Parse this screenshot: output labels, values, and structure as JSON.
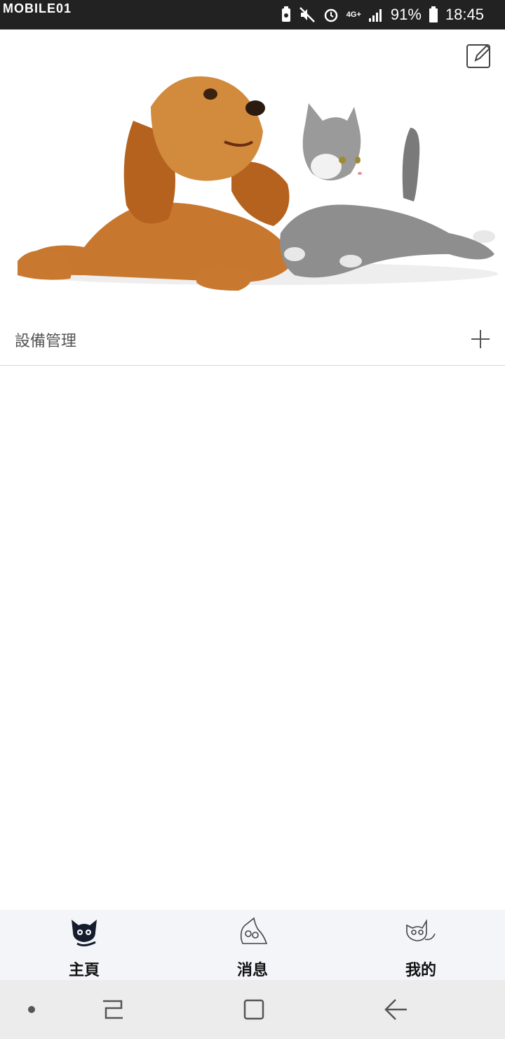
{
  "status_bar": {
    "watermark": "MOBILE01",
    "network": "4G+",
    "battery": "91%",
    "time": "18:45"
  },
  "hero": {
    "image": "dog-and-cat-photo",
    "edit_icon": "edit-icon"
  },
  "devices": {
    "title": "設備管理",
    "add_icon": "plus-icon"
  },
  "tabs": [
    {
      "label": "主頁",
      "icon": "cat-home-icon",
      "active": true
    },
    {
      "label": "消息",
      "icon": "cat-message-icon",
      "active": false
    },
    {
      "label": "我的",
      "icon": "cat-profile-icon",
      "active": false
    }
  ],
  "nav": [
    "dot-icon",
    "recents-icon",
    "home-icon",
    "back-icon"
  ]
}
